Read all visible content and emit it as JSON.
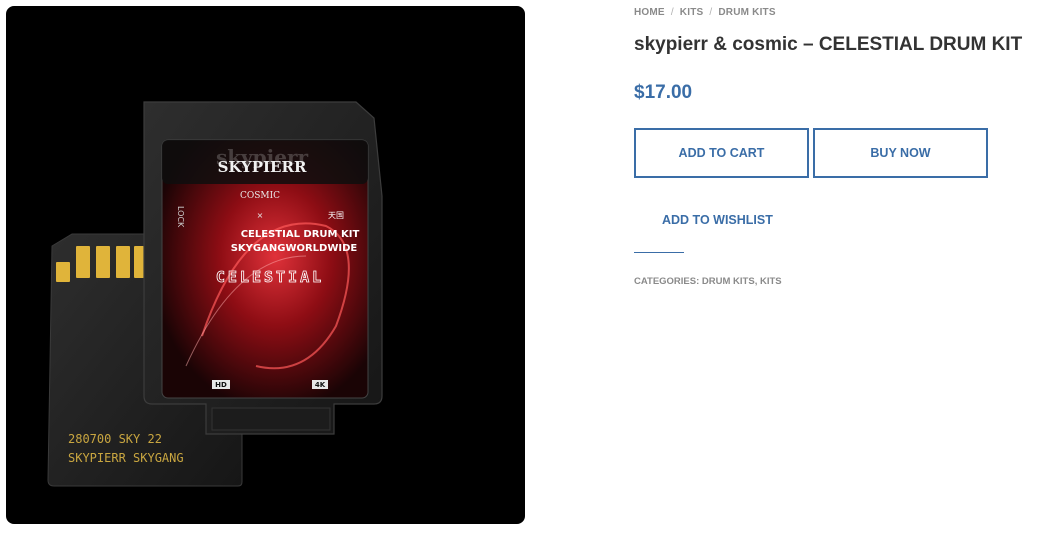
{
  "breadcrumb": {
    "home": "HOME",
    "kits": "KITS",
    "drum_kits": "DRUM KITS",
    "separator": "/"
  },
  "product": {
    "title": "skypierr & cosmic – CELESTIAL DRUM KIT",
    "price": "$17.00"
  },
  "buttons": {
    "add_to_cart": "ADD TO CART",
    "buy_now": "BUY NOW",
    "add_to_wishlist": "ADD TO WISHLIST"
  },
  "meta": {
    "categories_label": "CATEGORIES:",
    "category_1": "DRUM KITS",
    "comma": ",",
    "category_2": "KITS"
  },
  "image": {
    "logo": "SKYPIERR",
    "logo_ghost": "skypierr",
    "collab_text": "COSMIC",
    "lock_label": "LOCK",
    "collab_marks": "×",
    "kanji": "天国",
    "card_line_1": "CELESTIAL DRUM KIT",
    "card_line_2": "SKYGANGWORLDWIDE",
    "card_graphic_title": "CELESTIAL",
    "badge_hd": "HD",
    "badge_4k": "4K",
    "serial_line_1": "280700 SKY 22",
    "serial_line_2": "SKYPIERR SKYGANG"
  },
  "colors": {
    "accent": "#3a6da7",
    "muted": "#8a8a8a",
    "title": "#333333",
    "card_red": "#b01018"
  }
}
